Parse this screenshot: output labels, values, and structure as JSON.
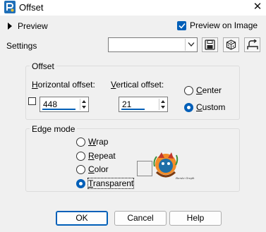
{
  "window": {
    "title": "Offset",
    "close_glyph": "✕"
  },
  "preview": {
    "toggle_label": "Preview",
    "on_image_label": "Preview on Image",
    "on_image_checked": true
  },
  "settings": {
    "label": "Settings",
    "combo_value": ""
  },
  "offset": {
    "group_title": "Offset",
    "horizontal": {
      "label_accel": "H",
      "label_rest": "orizontal offset:",
      "value": "448"
    },
    "vertical": {
      "label_accel": "V",
      "label_rest": "ertical offset:",
      "value": "21"
    },
    "center_label_accel": "C",
    "center_label_rest": "enter",
    "custom_label_accel": "C",
    "custom_label_rest": "ustom",
    "selected": "custom"
  },
  "edge_mode": {
    "group_title": "Edge mode",
    "options": [
      {
        "accel": "W",
        "rest": "rap"
      },
      {
        "accel": "R",
        "rest": "epeat"
      },
      {
        "accel": "C",
        "rest": "olor"
      },
      {
        "accel": "T",
        "rest": "ransparent"
      }
    ],
    "selected": "Transparent",
    "thumbnail_caption": "Renée Graph"
  },
  "buttons": {
    "ok": "OK",
    "cancel": "Cancel",
    "help": "Help"
  },
  "colors": {
    "accent": "#005fb8",
    "dialog_bg": "#f0f0f0"
  },
  "icons": [
    "app-icon",
    "close-icon",
    "expand-triangle-icon",
    "dropdown-arrow-icon",
    "save-preset-icon",
    "randomize-icon",
    "reset-icon",
    "checkmark-icon"
  ]
}
